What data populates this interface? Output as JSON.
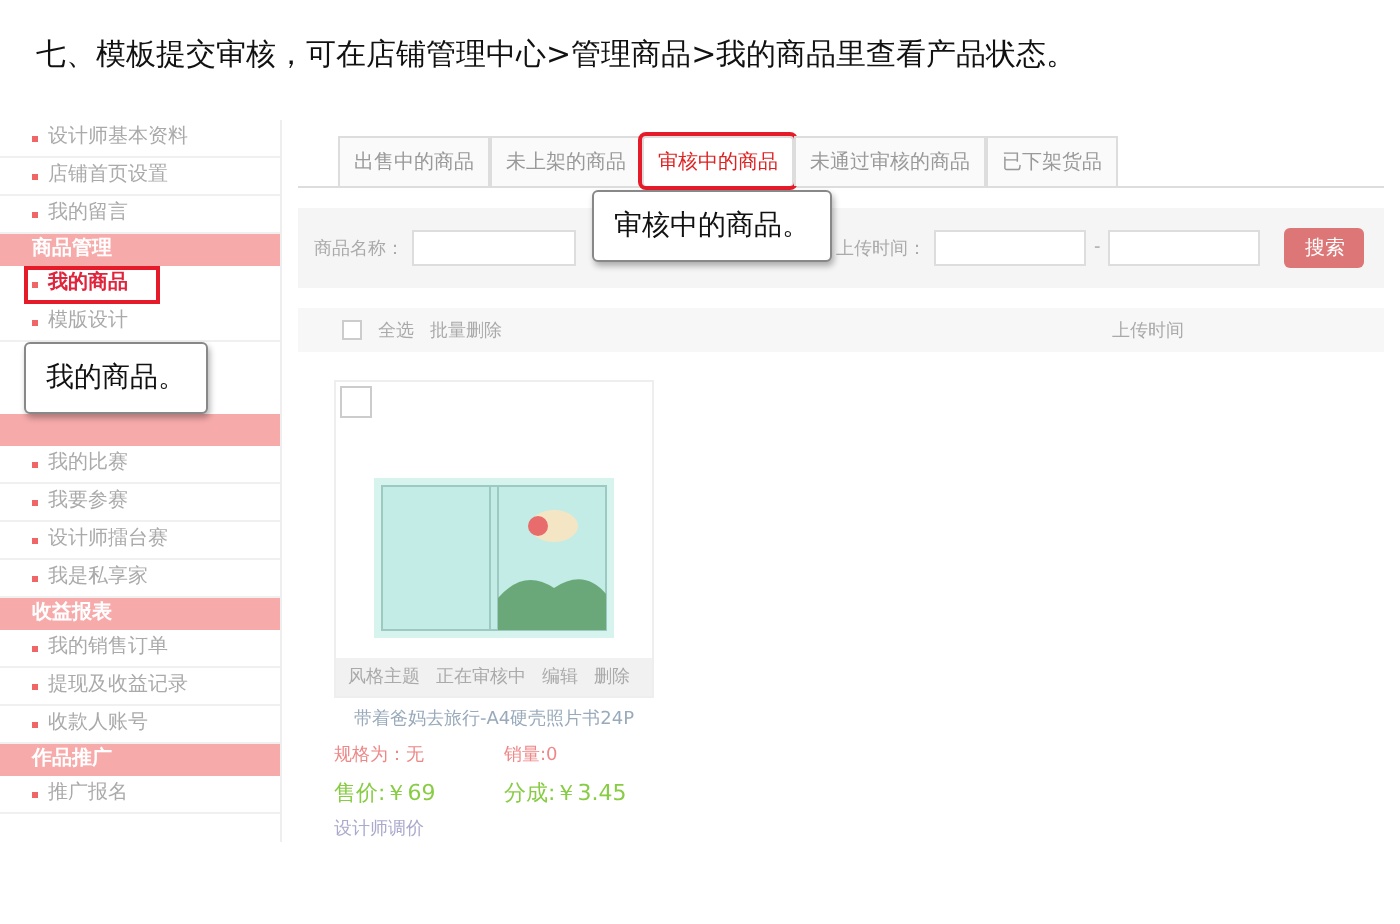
{
  "heading": "七、模板提交审核，可在店铺管理中心>管理商品>我的商品里查看产品状态。",
  "sidebar": {
    "sections": [
      {
        "items": [
          {
            "label": "设计师基本资料",
            "selected": false
          },
          {
            "label": "店铺首页设置",
            "selected": false
          },
          {
            "label": "我的留言",
            "selected": false
          }
        ]
      },
      {
        "title": "商品管理",
        "items": [
          {
            "label": "我的商品",
            "selected": true
          },
          {
            "label": "模版设计",
            "selected": false
          }
        ]
      },
      {
        "items": [
          {
            "label": "我的比赛",
            "selected": false
          },
          {
            "label": "我要参赛",
            "selected": false
          },
          {
            "label": "设计师擂台赛",
            "selected": false
          },
          {
            "label": "我是私享家",
            "selected": false
          }
        ]
      },
      {
        "title": "收益报表",
        "items": [
          {
            "label": "我的销售订单",
            "selected": false
          },
          {
            "label": "提现及收益记录",
            "selected": false
          },
          {
            "label": "收款人账号",
            "selected": false
          }
        ]
      },
      {
        "title": "作品推广",
        "items": [
          {
            "label": "推广报名",
            "selected": false
          }
        ]
      }
    ]
  },
  "tabs": [
    {
      "label": "出售中的商品",
      "selected": false
    },
    {
      "label": "未上架的商品",
      "selected": false
    },
    {
      "label": "审核中的商品",
      "selected": true
    },
    {
      "label": "未通过审核的商品",
      "selected": false
    },
    {
      "label": "已下架货品",
      "selected": false
    }
  ],
  "filter": {
    "name_label": "商品名称：",
    "time_label": "上传时间：",
    "separator": "-",
    "search_button": "搜索"
  },
  "toolbar": {
    "select_all": "全选",
    "select_all_checked": false,
    "batch_delete": "批量删除",
    "upload_time": "上传时间"
  },
  "product": {
    "checked": false,
    "actions": [
      "风格主题",
      "正在审核中",
      "编辑",
      "删除"
    ],
    "title": "带着爸妈去旅行-A4硬壳照片书24P",
    "spec": "规格为：无",
    "sales": "销量:0",
    "price": "售价:￥69",
    "share": "分成:￥3.45",
    "adjust": "设计师调价"
  },
  "callouts": [
    {
      "text": "我的商品。"
    },
    {
      "text": "审核中的商品。"
    }
  ]
}
